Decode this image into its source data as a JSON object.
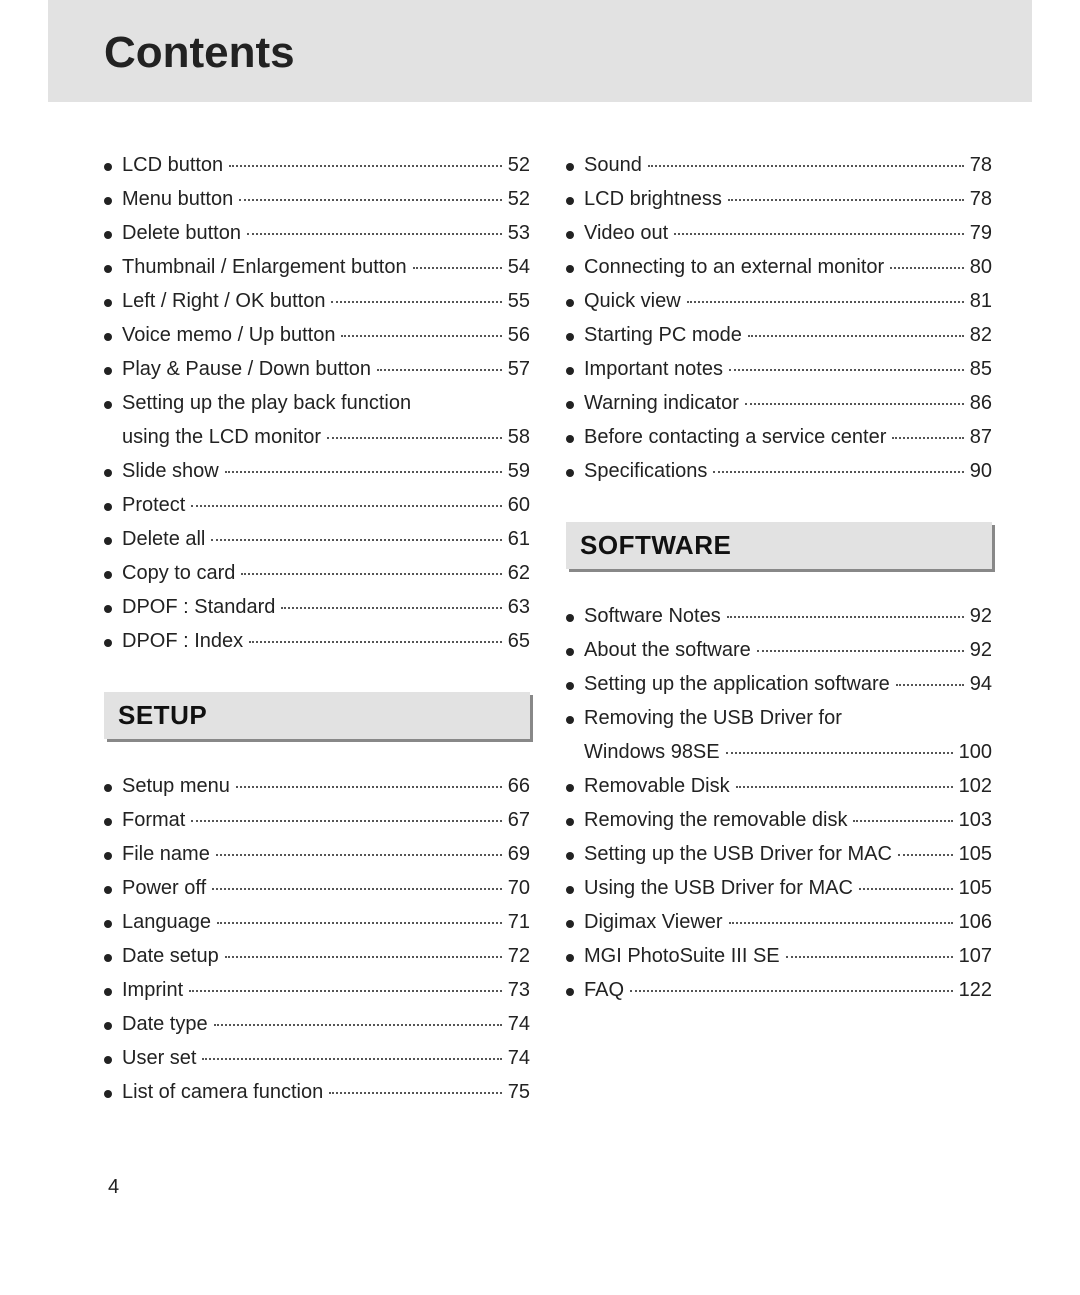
{
  "title": "Contents",
  "page_number": "4",
  "sections": {
    "setup": "SETUP",
    "software": "SOFTWARE"
  },
  "left_top": [
    {
      "label": "LCD button",
      "page": "52"
    },
    {
      "label": "Menu button",
      "page": "52"
    },
    {
      "label": "Delete button",
      "page": "53"
    },
    {
      "label": "Thumbnail / Enlargement button",
      "page": "54"
    },
    {
      "label": "Left / Right / OK button",
      "page": "55"
    },
    {
      "label": "Voice memo / Up button",
      "page": "56"
    },
    {
      "label": "Play & Pause / Down button",
      "page": "57"
    },
    {
      "label": "Setting up the play back function",
      "page": ""
    },
    {
      "label": "using the LCD monitor",
      "page": "58",
      "indent": true
    },
    {
      "label": "Slide show",
      "page": "59"
    },
    {
      "label": "Protect",
      "page": "60"
    },
    {
      "label": "Delete all",
      "page": "61"
    },
    {
      "label": "Copy to card",
      "page": "62"
    },
    {
      "label": "DPOF : Standard",
      "page": "63"
    },
    {
      "label": "DPOF : Index",
      "page": "65"
    }
  ],
  "left_setup": [
    {
      "label": "Setup menu",
      "page": "66"
    },
    {
      "label": "Format",
      "page": "67"
    },
    {
      "label": "File name",
      "page": "69"
    },
    {
      "label": "Power off",
      "page": "70"
    },
    {
      "label": "Language",
      "page": "71"
    },
    {
      "label": "Date setup",
      "page": "72"
    },
    {
      "label": "Imprint",
      "page": "73"
    },
    {
      "label": "Date type",
      "page": "74"
    },
    {
      "label": "User set",
      "page": "74"
    },
    {
      "label": "List of camera function",
      "page": "75"
    }
  ],
  "right_top": [
    {
      "label": "Sound",
      "page": "78"
    },
    {
      "label": "LCD brightness",
      "page": "78"
    },
    {
      "label": "Video out",
      "page": "79"
    },
    {
      "label": "Connecting to an external monitor",
      "page": "80"
    },
    {
      "label": "Quick view",
      "page": "81"
    },
    {
      "label": "Starting PC mode",
      "page": "82"
    },
    {
      "label": "Important notes",
      "page": "85"
    },
    {
      "label": "Warning indicator",
      "page": "86"
    },
    {
      "label": "Before contacting a service center",
      "page": "87"
    },
    {
      "label": "Specifications",
      "page": "90"
    }
  ],
  "right_software": [
    {
      "label": "Software Notes",
      "page": "92"
    },
    {
      "label": "About the software",
      "page": "92"
    },
    {
      "label": "Setting up the application software",
      "page": "94"
    },
    {
      "label": "Removing the USB Driver for",
      "page": ""
    },
    {
      "label": "Windows 98SE",
      "page": "100",
      "indent": true
    },
    {
      "label": "Removable Disk",
      "page": "102"
    },
    {
      "label": "Removing the removable disk",
      "page": "103"
    },
    {
      "label": "Setting up the USB Driver for MAC",
      "page": "105"
    },
    {
      "label": "Using the USB Driver for MAC",
      "page": "105"
    },
    {
      "label": "Digimax Viewer",
      "page": "106"
    },
    {
      "label": "MGI PhotoSuite III SE",
      "page": "107"
    },
    {
      "label": "FAQ",
      "page": "122"
    }
  ]
}
